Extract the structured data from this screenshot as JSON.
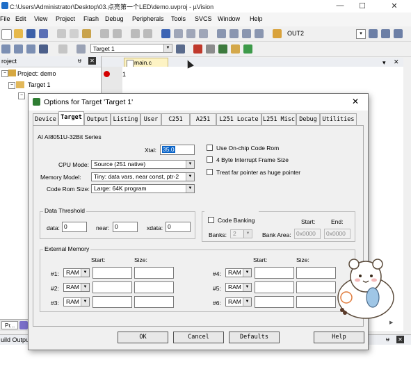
{
  "window": {
    "title": "C:\\Users\\Administrator\\Desktop\\03.点亮第一个LED\\demo.uvproj - µVision",
    "controls": {
      "minimize": "—",
      "maximize": "☐",
      "close": "✕"
    }
  },
  "menubar": [
    "File",
    "Edit",
    "View",
    "Project",
    "Flash",
    "Debug",
    "Peripherals",
    "Tools",
    "SVCS",
    "Window",
    "Help"
  ],
  "toolbar": {
    "target_combo": "OUT2",
    "target_select": "Target 1"
  },
  "project_panel": {
    "title": "roject",
    "pin": "ᵾ",
    "close": "✕",
    "tree": [
      {
        "label": "Project: demo"
      },
      {
        "label": "Target 1"
      }
    ],
    "tabs": [
      "Pr...",
      ""
    ],
    "build_output": "uild Output"
  },
  "editor": {
    "tab_label": "main.c",
    "line_numbers": [
      "1"
    ],
    "panel_controls": {
      "dropdown": "▾",
      "close": "✕"
    }
  },
  "dialog": {
    "title": "Options for Target 'Target 1'",
    "close": "✕",
    "tabs": [
      "Device",
      "Target",
      "Output",
      "Listing",
      "User",
      "C251",
      "A251",
      "L251 Locate",
      "L251 Misc",
      "Debug",
      "Utilities"
    ],
    "active_tab": "Target",
    "device_name": "AI AI8051U-32Bit Series",
    "xtal": {
      "label": "Xtal:",
      "value": "35.0"
    },
    "cpu_mode": {
      "label": "CPU Mode:",
      "value": "Source (251 native)"
    },
    "memory_model": {
      "label": "Memory Model:",
      "value": "Tiny: data vars, near const, ptr-2"
    },
    "code_rom_size": {
      "label": "Code Rom Size:",
      "value": "Large: 64K program"
    },
    "options": [
      {
        "label": "Use On-chip Code Rom",
        "checked": false
      },
      {
        "label": "4 Byte Interrupt Frame Size",
        "checked": false
      },
      {
        "label": "Treat far pointer as huge pointer",
        "checked": false
      }
    ],
    "data_threshold": {
      "title": "Data Threshold",
      "data": {
        "label": "data:",
        "value": "0"
      },
      "near": {
        "label": "near:",
        "value": "0"
      },
      "xdata": {
        "label": "xdata:",
        "value": "0"
      }
    },
    "code_banking": {
      "label": "Code Banking",
      "banks_label": "Banks:",
      "banks_value": "2",
      "start_label": "Start:",
      "end_label": "End:",
      "bank_area_label": "Bank Area:",
      "start_value": "0x0000",
      "end_value": "0x0000"
    },
    "external_memory": {
      "title": "External Memory",
      "start_label": "Start:",
      "size_label": "Size:",
      "rows_left": [
        {
          "label": "#1:",
          "type": "RAM"
        },
        {
          "label": "#2:",
          "type": "RAM"
        },
        {
          "label": "#3:",
          "type": "RAM"
        }
      ],
      "rows_right": [
        {
          "label": "#4:",
          "type": "RAM"
        },
        {
          "label": "#5:",
          "type": "RAM"
        },
        {
          "label": "#6:",
          "type": "RAM"
        }
      ]
    },
    "buttons": {
      "ok": "OK",
      "cancel": "Cancel",
      "defaults": "Defaults",
      "help": "Help"
    }
  },
  "colors": {
    "accent": "#1e6ec8",
    "xtal_highlight": "#0a64c8",
    "breakpoint": "#d40000"
  }
}
